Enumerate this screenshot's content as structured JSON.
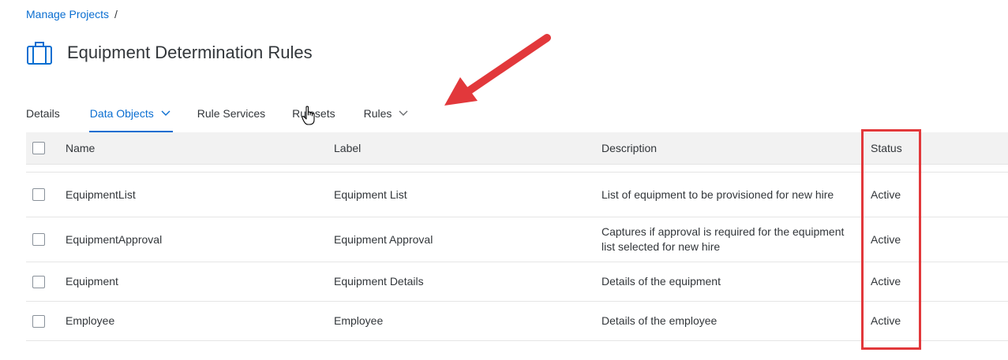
{
  "breadcrumb": {
    "link": "Manage Projects",
    "separator": "/"
  },
  "header": {
    "icon": "briefcase-icon",
    "title": "Equipment Determination Rules"
  },
  "tabs": [
    {
      "label": "Details",
      "has_dropdown": false,
      "active": false
    },
    {
      "label": "Data Objects",
      "has_dropdown": true,
      "active": true
    },
    {
      "label": "Rule Services",
      "has_dropdown": false,
      "active": false
    },
    {
      "label": "Rulesets",
      "has_dropdown": false,
      "active": false
    },
    {
      "label": "Rules",
      "has_dropdown": true,
      "active": false
    }
  ],
  "table": {
    "columns": [
      "Name",
      "Label",
      "Description",
      "Status"
    ],
    "rows": [
      {
        "name": "EquipmentList",
        "label": "Equipment List",
        "description": "List of equipment to be provisioned for new hire",
        "status": "Active"
      },
      {
        "name": "EquipmentApproval",
        "label": "Equipment Approval",
        "description": "Captures if approval is required for the equipment list selected for new hire",
        "status": "Active"
      },
      {
        "name": "Equipment",
        "label": "Equipment Details",
        "description": "Details of the equipment",
        "status": "Active"
      },
      {
        "name": "Employee",
        "label": "Employee",
        "description": "Details of the employee",
        "status": "Active"
      }
    ]
  },
  "colors": {
    "accent": "#0a6ed1",
    "text": "#32363a",
    "header_bg": "#f2f2f2",
    "annotation": "#e2383b"
  },
  "annotations": {
    "arrow_icon": "red-arrow-icon",
    "highlight": "status-column-highlight",
    "cursor_icon": "hand-cursor-icon"
  }
}
